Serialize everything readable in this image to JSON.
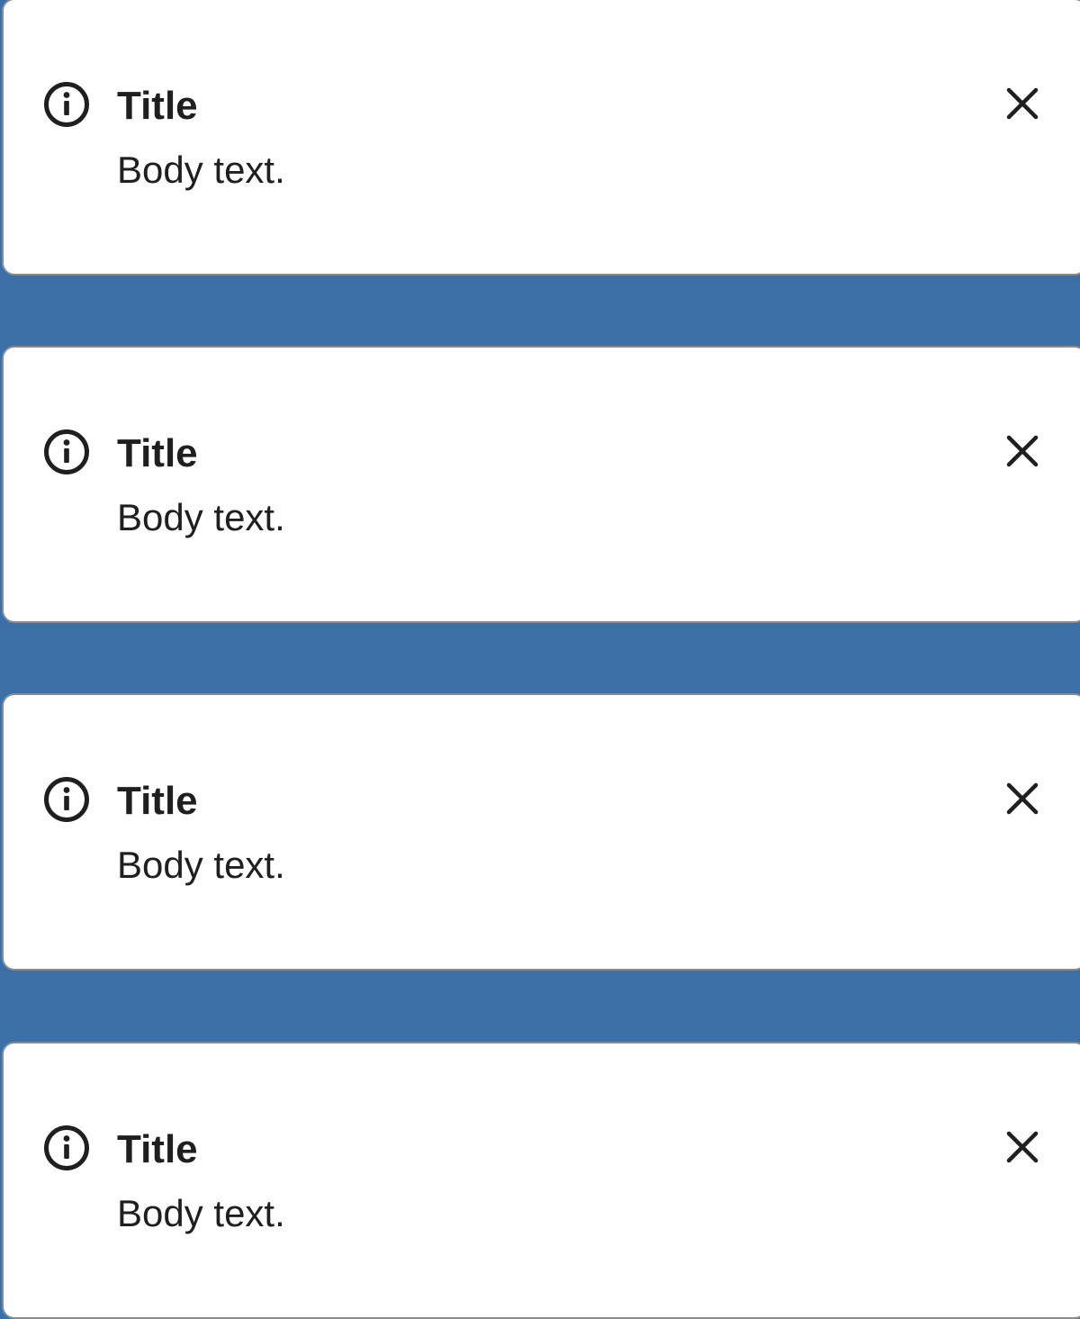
{
  "colors": {
    "background": "#3c6fa6",
    "card": "#ffffff",
    "text": "#1f1f1f",
    "border": "#8a8a8a"
  },
  "notifications": [
    {
      "icon": "info-icon",
      "title": "Title",
      "body": "Body text.",
      "close_icon": "close-icon"
    },
    {
      "icon": "info-icon",
      "title": "Title",
      "body": "Body text.",
      "close_icon": "close-icon"
    },
    {
      "icon": "info-icon",
      "title": "Title",
      "body": "Body text.",
      "close_icon": "close-icon"
    },
    {
      "icon": "info-icon",
      "title": "Title",
      "body": "Body text.",
      "close_icon": "close-icon"
    }
  ]
}
